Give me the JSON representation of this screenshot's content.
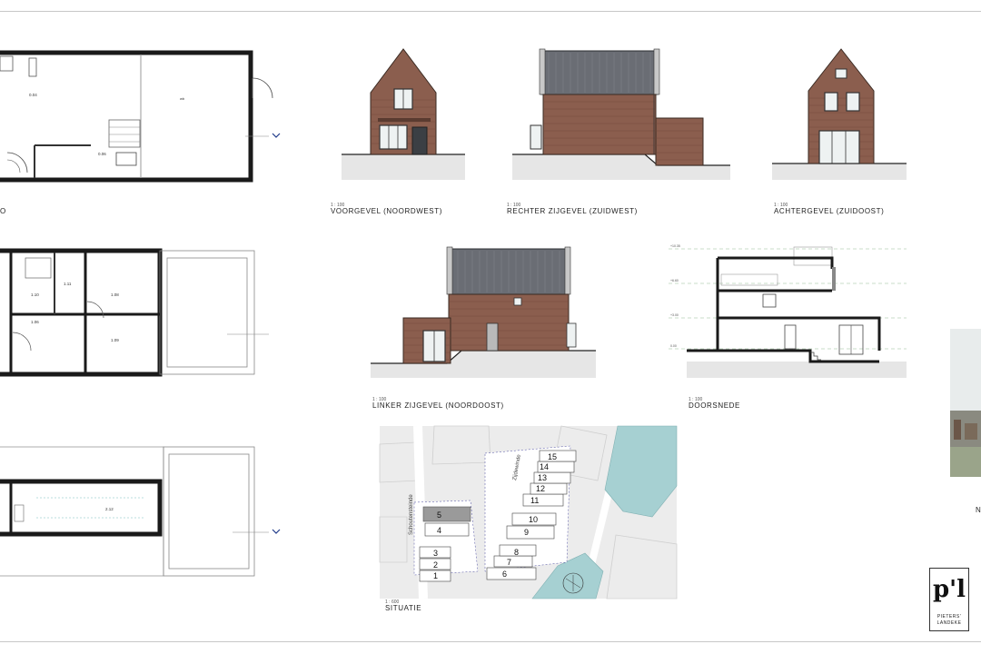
{
  "sheet": {
    "views": {
      "plan_ground_caption": "O",
      "voorgevel_scale": "1 : 100",
      "voorgevel_caption": "VOORGEVEL (NOORDWEST)",
      "rechter_scale": "1 : 100",
      "rechter_caption": "RECHTER ZIJGEVEL (ZUIDWEST)",
      "achter_scale": "1 : 100",
      "achter_caption": "ACHTERGEVEL (ZUIDOOST)",
      "linker_scale": "1 : 100",
      "linker_caption": "LINKER ZIJGEVEL (NOORDOOST)",
      "doorsnede_scale": "1 : 100",
      "doorsnede_caption": "DOORSNEDE",
      "situatie_scale": "1 : 600",
      "situatie_caption": "SITUATIE",
      "right_edge_letter": "N"
    },
    "room_labels": {
      "ground_main": "0.04",
      "ground_wc": "0.05",
      "ground_small": "0.06",
      "first_a": "1.10",
      "first_b": "1.11",
      "first_c": "1.08",
      "first_d": "1.09",
      "first_e": "1.06",
      "attic": "2.12"
    },
    "situatie": {
      "roads": [
        "Schoutensteinde",
        "Zijdewinde"
      ],
      "plots": [
        "1",
        "2",
        "3",
        "4",
        "5",
        "6",
        "7",
        "8",
        "9",
        "10",
        "11",
        "12",
        "13",
        "14",
        "15"
      ]
    },
    "logo": {
      "mark": "p'l",
      "line1": "PIETERS'",
      "line2": "LANDEKE"
    },
    "colors": {
      "brick": "#8b5e4e",
      "roof": "#6a6d74",
      "water": "#a6d0d2",
      "building": "#9a9a9a",
      "ground": "#e6e6e6"
    }
  }
}
